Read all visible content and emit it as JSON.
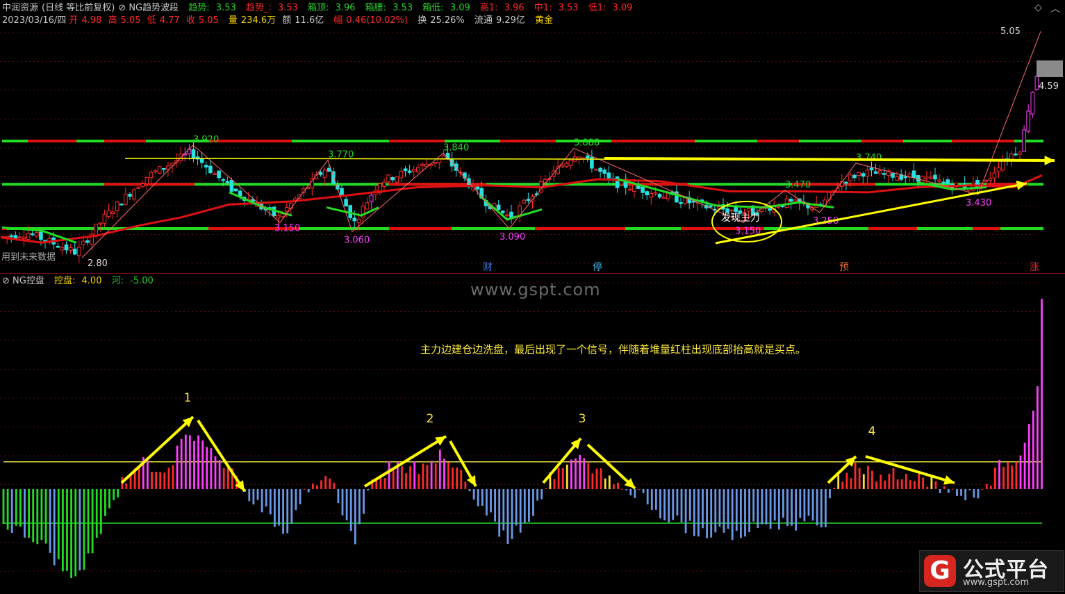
{
  "header": {
    "title": "中润资源",
    "mode": "(日线 等比前复权)",
    "indicator": "NG趋势波段",
    "trend_label": "趋势:",
    "trend_val": "3.53",
    "trend2_label": "趋势_:",
    "trend2_val": "3.53",
    "box_top_label": "箱顶:",
    "box_top_val": "3.96",
    "box_mid_label": "箱腰:",
    "box_mid_val": "3.53",
    "box_low_label": "箱低:",
    "box_low_val": "3.09",
    "high1_label": "高1:",
    "high1_val": "3.96",
    "mid1_label": "中1:",
    "mid1_val": "3.53",
    "low1_label": "低1:",
    "low1_val": "3.09"
  },
  "quote": {
    "date": "2023/03/16/四",
    "open_label": "开",
    "open": "4.98",
    "high_label": "高",
    "high": "5.05",
    "low_label": "低",
    "low": "4.77",
    "close_label": "收",
    "close": "5.05",
    "vol_label": "量",
    "vol": "234.6万",
    "amt_label": "额",
    "amt": "11.6亿",
    "chg_label": "幅",
    "chg": "0.46(10.02%)",
    "turn_label": "换",
    "turn": "25.26%",
    "float_label": "流通",
    "float": "9.29亿",
    "tag": "黄金"
  },
  "sub_header": {
    "indicator": "NG控盘",
    "ctrl_label": "控盘:",
    "ctrl_val": "4.00",
    "river_label": "河:",
    "river_val": "-5.00"
  },
  "watermark": "www.gspt.com",
  "logo": {
    "icon": "G",
    "title": "公式平台",
    "url": "www.gspt.com"
  },
  "labels": {
    "future_data": "用到未来数据",
    "discover": "发现主力",
    "annotation": "主力边建仓边洗盘，最后出现了一个信号，伴随着堆量红柱出现底部抬高就是买点。",
    "n1": "1",
    "n2": "2",
    "n3": "3",
    "n4": "4",
    "ev_cai": "财",
    "ev_ting": "停",
    "ev_yu": "预",
    "ev_zhang": "涨"
  },
  "icons": {
    "diamond": "◇",
    "chevron": "︿"
  },
  "colors": {
    "up": "#ff2a2a",
    "down": "#27e0e0",
    "limit": "#ff3fff",
    "green_line": "#22dd22",
    "red_line": "#e01010",
    "arrow": "#ffff00",
    "zigzag": "#ff6a6a",
    "bar_blue": "#6a98e8"
  },
  "chart_data": [
    {
      "type": "candlestick",
      "title": "中润资源 日线",
      "ylim": [
        2.75,
        5.15
      ],
      "box_levels": {
        "top": 3.96,
        "mid": 3.53,
        "low": 3.09
      },
      "price_labels": [
        "5.05",
        "4.59",
        "3.920",
        "3.770",
        "3.840",
        "3.888",
        "3.740",
        "3.470",
        "3.430",
        "3.150",
        "3.060",
        "3.090",
        "3.150",
        "3.250",
        "2.80"
      ],
      "pivots": [
        {
          "label": "2.80",
          "value": 2.8
        },
        {
          "label": "3.920",
          "value": 3.92
        },
        {
          "label": "3.150",
          "value": 3.15
        },
        {
          "label": "3.770",
          "value": 3.77
        },
        {
          "label": "3.060",
          "value": 3.06
        },
        {
          "label": "3.840",
          "value": 3.84
        },
        {
          "label": "3.090",
          "value": 3.09
        },
        {
          "label": "3.888",
          "value": 3.888
        },
        {
          "label": "3.150",
          "value": 3.15
        },
        {
          "label": "3.470",
          "value": 3.47
        },
        {
          "label": "3.250",
          "value": 3.25
        },
        {
          "label": "3.740",
          "value": 3.74
        },
        {
          "label": "3.430",
          "value": 3.43
        },
        {
          "label": "5.05",
          "value": 5.05
        }
      ],
      "last_bar": {
        "open": 4.98,
        "high": 5.05,
        "low": 4.77,
        "close": 5.05
      }
    },
    {
      "type": "bar",
      "title": "NG控盘",
      "ctrl_level": 4.0,
      "river_level": -5.0,
      "zero": 0,
      "waves": [
        "1",
        "2",
        "3",
        "4"
      ]
    }
  ]
}
